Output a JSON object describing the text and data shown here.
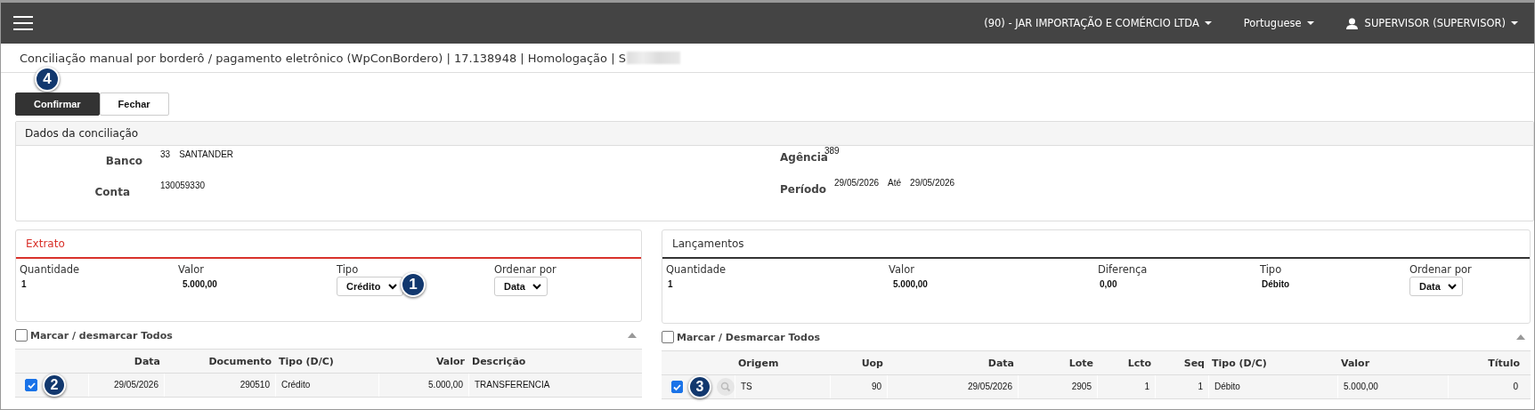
{
  "topbar": {
    "company": "(90) - JAR IMPORTAÇÃO E COMÉRCIO LTDA",
    "language": "Portuguese",
    "user": "SUPERVISOR (SUPERVISOR)"
  },
  "page_title": "Conciliação manual por borderô / pagamento eletrônico (WpConBordero) | 17.138948 | Homologação | S",
  "buttons": [
    {
      "label": "Confirmar",
      "primary": true,
      "callout": "4"
    },
    {
      "label": "Fechar",
      "primary": false
    }
  ],
  "dados": {
    "title": "Dados da conciliação",
    "columns": [
      [
        {
          "label": "Banco",
          "values": [
            "33",
            "SANTANDER"
          ]
        },
        {
          "label": "Conta",
          "values": [
            "130059330"
          ]
        }
      ],
      [
        {
          "label": "Agência",
          "values": [
            "389"
          ]
        },
        {
          "label": "Período",
          "values": [
            "29/05/2026",
            "Até",
            "29/05/2026"
          ]
        }
      ]
    ]
  },
  "panels": [
    {
      "title": "Extrato",
      "color": "#d9322b",
      "summary": [
        {
          "kind": "text",
          "label": "Quantidade",
          "value": "1"
        },
        {
          "kind": "text",
          "label": "Valor",
          "value": "5.000,00"
        },
        {
          "kind": "select",
          "label": "Tipo",
          "value": "Crédito",
          "callout": "1"
        },
        {
          "kind": "select",
          "label": "Ordenar por",
          "value": "Data"
        }
      ],
      "check_all": {
        "label": "Marcar / desmarcar Todos",
        "checked": false
      },
      "columns": [
        "Data",
        "Documento",
        "Tipo (D/C)",
        "Valor",
        "Descrição"
      ],
      "rows": [
        {
          "checked": true,
          "callout": "2",
          "cells": [
            "29/05/2026",
            "290510",
            "Crédito",
            "5.000,00",
            "TRANSFERENCIA"
          ]
        }
      ]
    },
    {
      "title": "Lançamentos",
      "color": "#333333",
      "summary": [
        {
          "kind": "text",
          "label": "Quantidade",
          "value": "1"
        },
        {
          "kind": "text",
          "label": "Valor",
          "value": "5.000,00"
        },
        {
          "kind": "text",
          "label": "Diferença",
          "value": "0,00"
        },
        {
          "kind": "text",
          "label": "Tipo",
          "value": "Débito"
        },
        {
          "kind": "select",
          "label": "Ordenar por",
          "value": "Data"
        }
      ],
      "check_all": {
        "label": "Marcar / Desmarcar Todos",
        "checked": false
      },
      "columns": [
        "Origem",
        "Uop",
        "Data",
        "Lote",
        "Lcto",
        "Seq",
        "Tipo (D/C)",
        "Valor",
        "Título"
      ],
      "rows": [
        {
          "checked": true,
          "callout": "3",
          "search": true,
          "cells": [
            "TS",
            "90",
            "29/05/2026",
            "2905",
            "1",
            "1",
            "Débito",
            "5.000,00",
            "0"
          ]
        }
      ]
    }
  ]
}
